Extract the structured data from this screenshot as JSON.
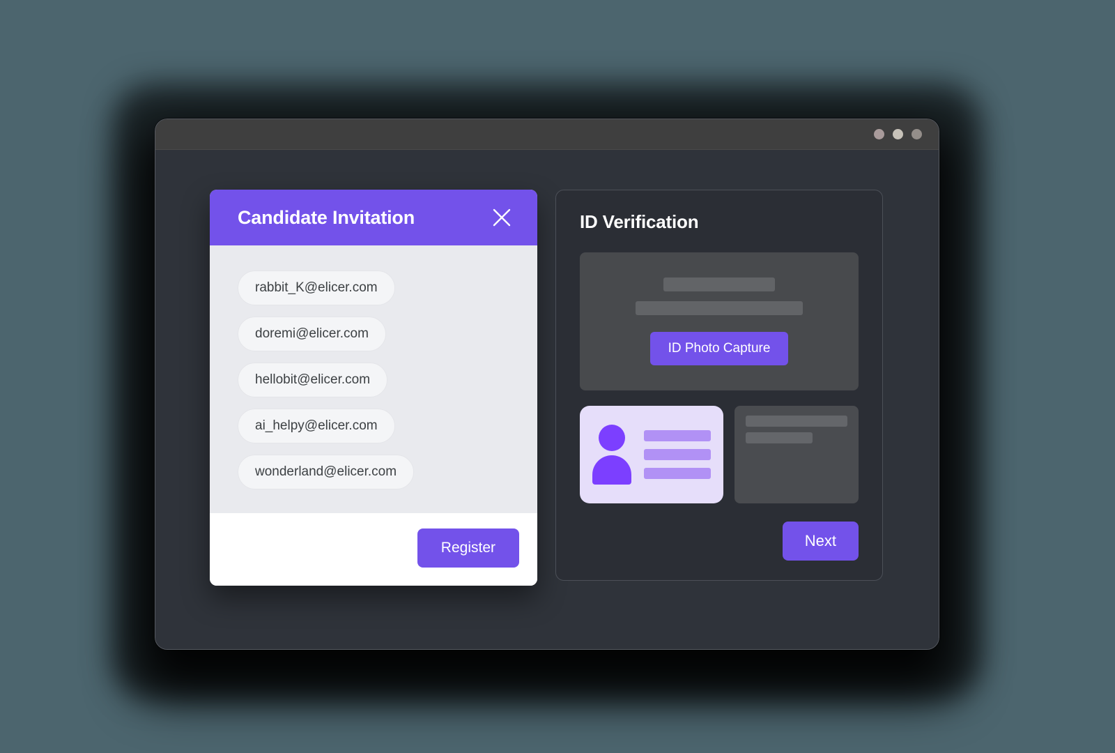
{
  "window": {
    "traffic_lights": [
      {
        "name": "window-dot-1",
        "color": "#a99b9b"
      },
      {
        "name": "window-dot-2",
        "color": "#c7c2b9"
      },
      {
        "name": "window-dot-3",
        "color": "#948e8a"
      }
    ]
  },
  "theme": {
    "accent": "#7352ea",
    "page_background": "#4c656e",
    "window_background": "#2f333a",
    "titlebar": "#3f3f3f",
    "modal_body": "#e9eaee",
    "modal_footer": "#ffffff",
    "panel_background": "#2b2e35",
    "photo_area": "#484a4d",
    "id_card_background": "#e6defa",
    "id_card_accent": "#7c3fff",
    "id_card_line": "#b191f5"
  },
  "modal": {
    "title": "Candidate Invitation",
    "close_icon": "close-icon",
    "emails": [
      "rabbit_K@elicer.com",
      "doremi@elicer.com",
      "hellobit@elicer.com",
      "ai_helpy@elicer.com",
      "wonderland@elicer.com"
    ],
    "register_label": "Register"
  },
  "panel": {
    "title": "ID Verification",
    "capture_label": "ID Photo Capture",
    "next_label": "Next",
    "id_card": {
      "icon": "person-avatar-icon",
      "line_count": 3
    },
    "placeholder_card": {
      "bars": 2
    }
  }
}
